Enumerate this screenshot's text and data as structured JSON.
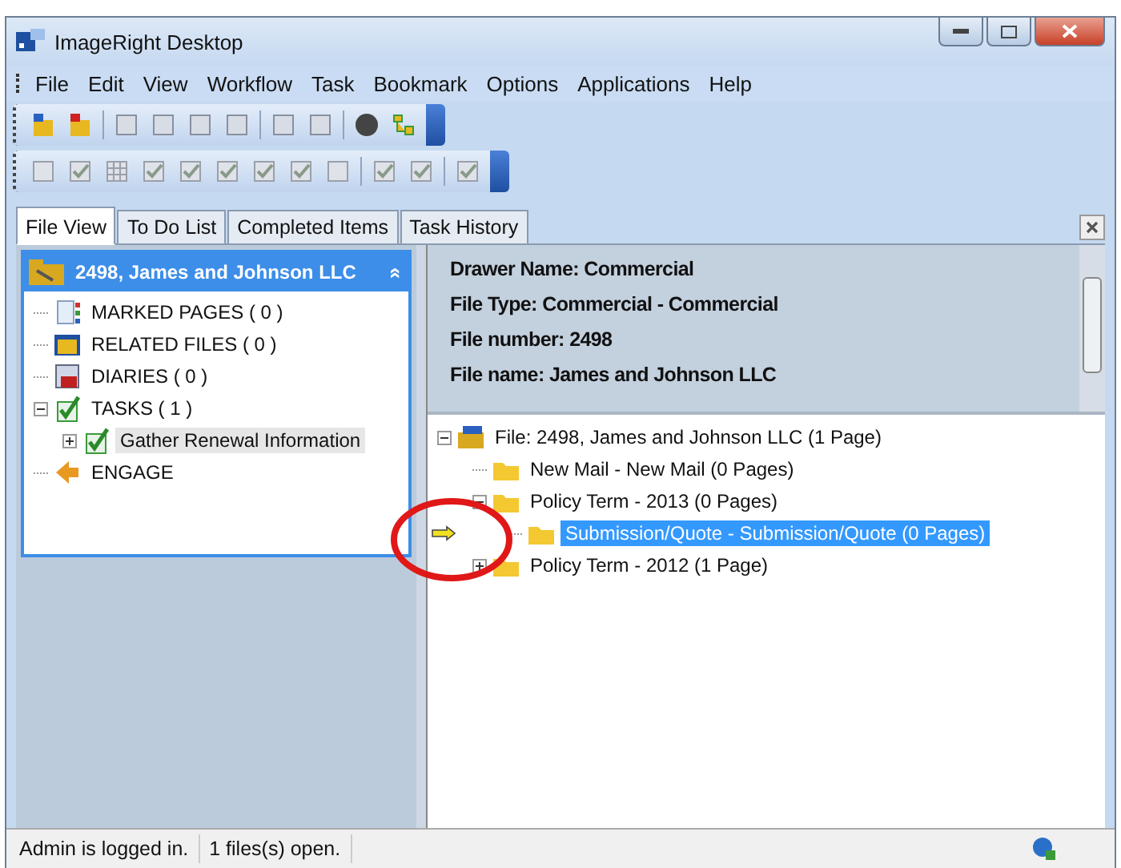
{
  "window": {
    "title": "ImageRight Desktop"
  },
  "menu": [
    "File",
    "Edit",
    "View",
    "Workflow",
    "Task",
    "Bookmark",
    "Options",
    "Applications",
    "Help"
  ],
  "tabs": [
    {
      "label": "File View",
      "selected": true
    },
    {
      "label": "To Do List",
      "selected": false
    },
    {
      "label": "Completed Items",
      "selected": false
    },
    {
      "label": "Task History",
      "selected": false
    }
  ],
  "left_panel": {
    "title": "2498, James and Johnson LLC",
    "collapse_glyph": "»",
    "items": [
      {
        "label": "MARKED PAGES ( 0 )",
        "kind": "pages",
        "selected": false
      },
      {
        "label": "RELATED FILES ( 0 )",
        "kind": "files",
        "selected": false
      },
      {
        "label": "DIARIES ( 0 )",
        "kind": "calendar",
        "selected": false
      },
      {
        "label": "TASKS ( 1 )",
        "kind": "tasks",
        "selected": false,
        "expanded": true,
        "children": [
          {
            "label": "Gather Renewal Information",
            "kind": "check",
            "selected": true,
            "expanded": false
          }
        ]
      },
      {
        "label": "ENGAGE",
        "kind": "engage",
        "selected": false
      }
    ]
  },
  "info": [
    "Drawer Name: Commercial",
    "File Type: Commercial - Commercial",
    "File number: 2498",
    "File name: James and Johnson LLC"
  ],
  "file_tree": [
    {
      "label": "File: 2498, James and Johnson LLC (1 Page)",
      "kind": "cabinet",
      "selected": false,
      "expanded": true,
      "children": [
        {
          "label": "New Mail - New Mail (0 Pages)",
          "kind": "folder",
          "selected": false
        },
        {
          "label": "Policy Term - 2013 (0 Pages)",
          "kind": "folder",
          "selected": false,
          "expanded": true,
          "children": [
            {
              "label": "Submission/Quote - Submission/Quote (0 Pages)",
              "kind": "folder",
              "selected": true,
              "pointer": true
            }
          ]
        },
        {
          "label": "Policy Term - 2012 (1 Page)",
          "kind": "folder",
          "selected": false,
          "expanded": false
        }
      ]
    }
  ],
  "status_bar": [
    "Admin is logged in.",
    "1 files(s) open."
  ]
}
